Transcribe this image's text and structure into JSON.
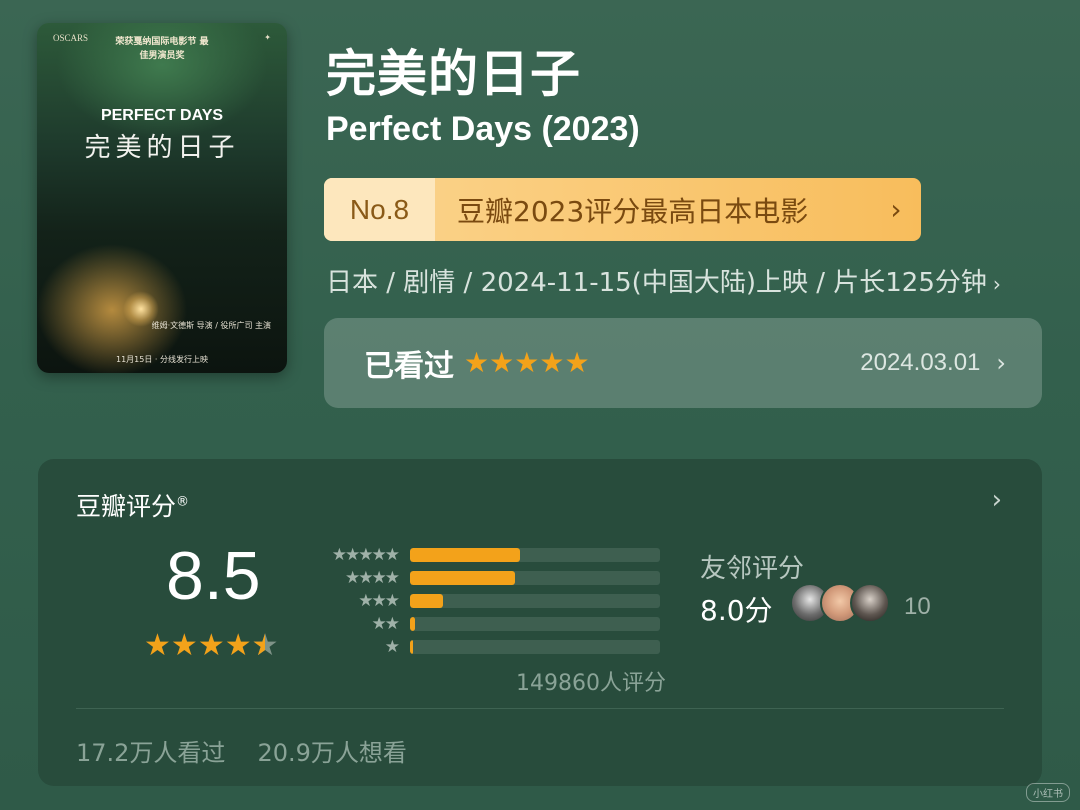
{
  "poster": {
    "oscars_text": "OSCARS",
    "award_text": "荣获戛纳国际电影节 最佳男演员奖",
    "title_en": "PERFECT DAYS",
    "title_zh": "完美的日子",
    "credit_text": "维姆·文德斯 导演 / 役所广司 主演",
    "release_text": "11月15日 · 分线发行上映"
  },
  "movie": {
    "title_zh": "完美的日子",
    "title_en": "Perfect Days (2023)",
    "meta": "日本 / 剧情 / 2024-11-15(中国大陆)上映 / 片长125分钟"
  },
  "rank": {
    "number": "No.8",
    "text": "豆瓣2023评分最高日本电影"
  },
  "watched": {
    "label": "已看过",
    "stars": 5,
    "date": "2024.03.01"
  },
  "rating": {
    "header": "豆瓣评分",
    "header_mark": "®",
    "score": "8.5",
    "stars_value": 4.5,
    "distribution": [
      {
        "stars": 5,
        "fraction": 0.44
      },
      {
        "stars": 4,
        "fraction": 0.42
      },
      {
        "stars": 3,
        "fraction": 0.13
      },
      {
        "stars": 2,
        "fraction": 0.02
      },
      {
        "stars": 1,
        "fraction": 0.01
      }
    ],
    "count_text": "149860人评分",
    "friend_label": "友邻评分",
    "friend_score": "8.0分",
    "friend_count": "10",
    "watched_text": "17.2万人看过",
    "want_text": "20.9万人想看"
  },
  "colors": {
    "background": "#33604d",
    "accent_star": "#f3a21a",
    "banner": "#f8bd5c"
  },
  "icons": {
    "chevron": "chevron-right-icon",
    "star": "star-icon"
  }
}
